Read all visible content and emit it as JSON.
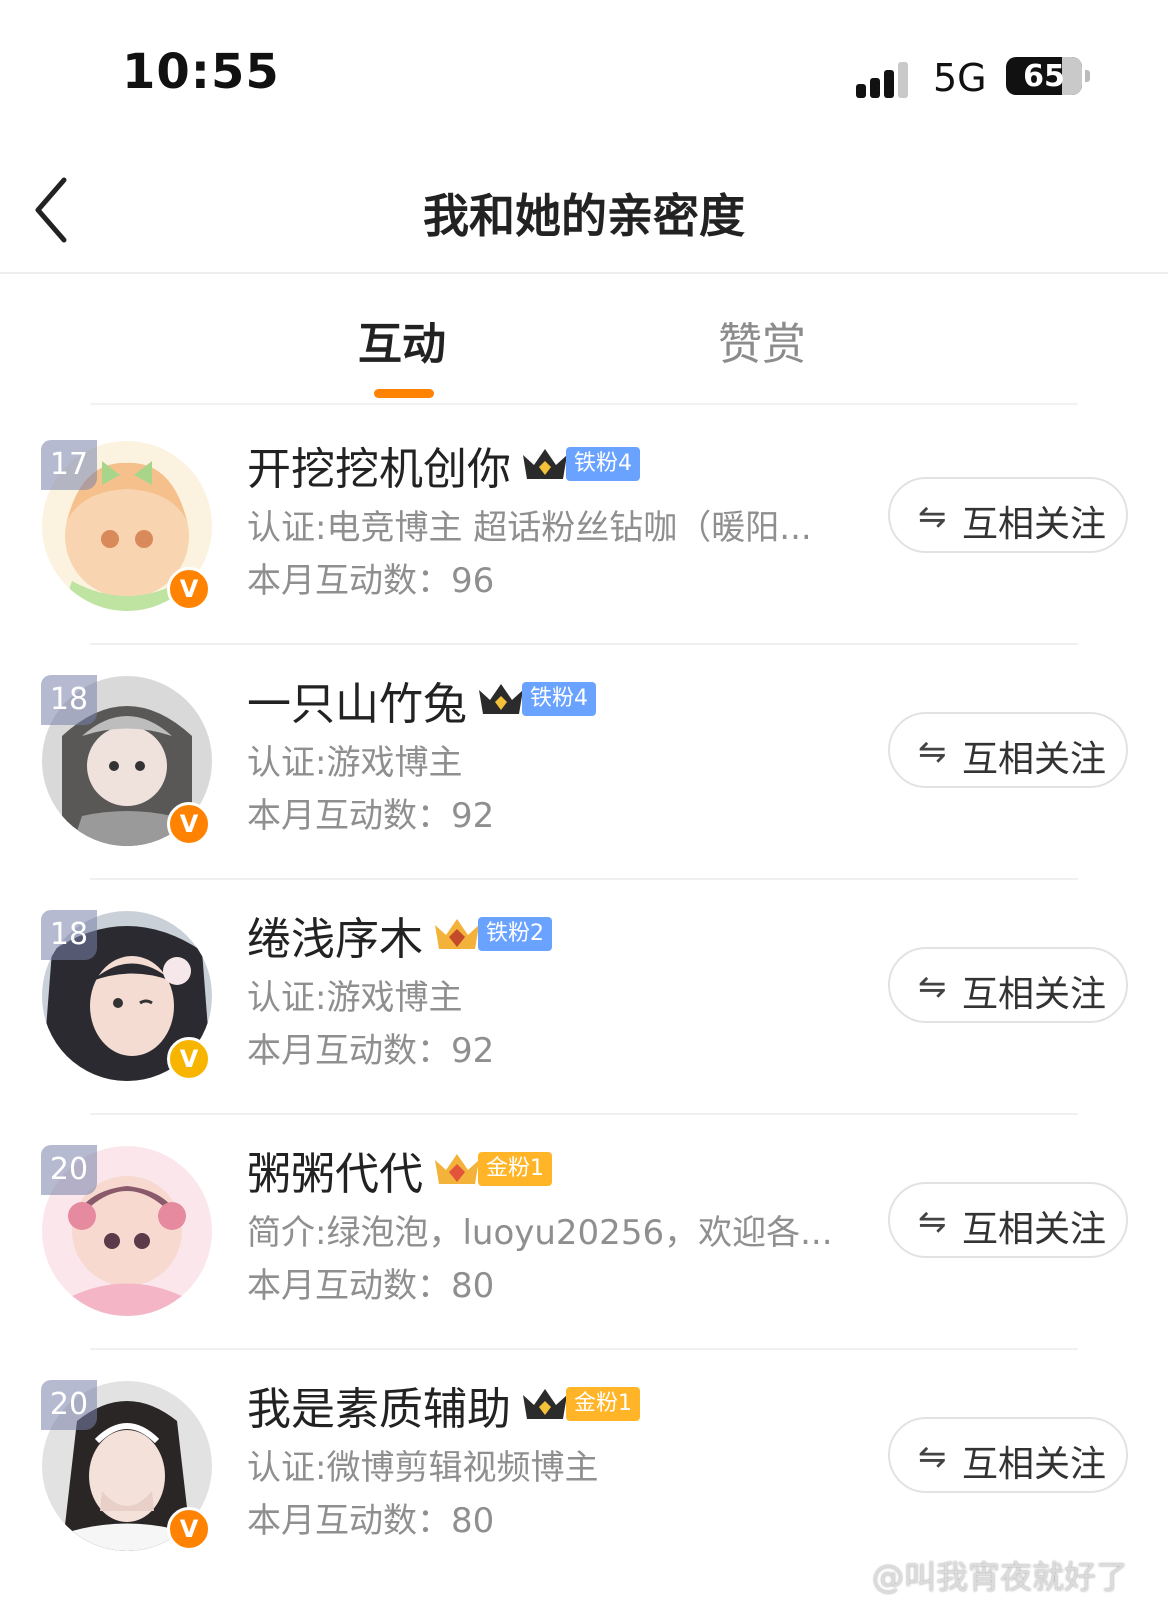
{
  "status_bar": {
    "time": "10:55",
    "network": "5G",
    "battery": "65"
  },
  "header": {
    "title": "我和她的亲密度"
  },
  "tabs": [
    {
      "label": "互动",
      "active": true
    },
    {
      "label": "赞赏",
      "active": false
    }
  ],
  "rows": [
    {
      "rank": "17",
      "name": "开挖挖机创你",
      "fan_label": "铁粉4",
      "fan_type": "iron",
      "desc": "认证:电竞博主 超话粉丝钻咖（暖阳...",
      "count": "本月互动数：96",
      "follow": "互相关注",
      "verify": "V",
      "verify_color": "orange"
    },
    {
      "rank": "18",
      "name": "一只山竹兔",
      "fan_label": "铁粉4",
      "fan_type": "iron",
      "desc": "认证:游戏博主",
      "count": "本月互动数：92",
      "follow": "互相关注",
      "verify": "V",
      "verify_color": "orange"
    },
    {
      "rank": "18",
      "name": "绻浅序木",
      "fan_label": "铁粉2",
      "fan_type": "iron",
      "desc": "认证:游戏博主",
      "count": "本月互动数：92",
      "follow": "互相关注",
      "verify": "V",
      "verify_color": "gold"
    },
    {
      "rank": "20",
      "name": "粥粥代代",
      "fan_label": "金粉1",
      "fan_type": "gold",
      "desc": "简介:绿泡泡，luoyu20256，欢迎各...",
      "count": "本月互动数：80",
      "follow": "互相关注",
      "verify": "",
      "verify_color": ""
    },
    {
      "rank": "20",
      "name": "我是素质辅助",
      "fan_label": "金粉1",
      "fan_type": "gold",
      "desc": "认证:微博剪辑视频博主",
      "count": "本月互动数：80",
      "follow": "互相关注",
      "verify": "V",
      "verify_color": "orange"
    }
  ],
  "follow_icon": "⇋",
  "watermark": "@叫我宵夜就好了",
  "colors": {
    "accent": "#ff8200",
    "iron_fan": "#6aa2ff",
    "gold_fan": "#ffb527"
  }
}
